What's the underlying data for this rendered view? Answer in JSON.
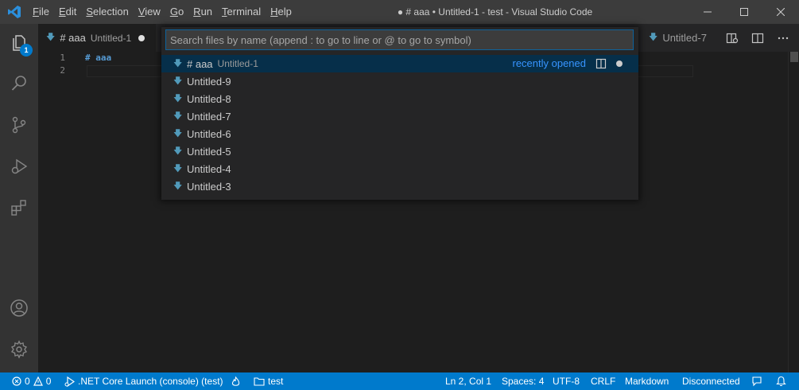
{
  "titlebar": {
    "menu": [
      "File",
      "Edit",
      "Selection",
      "View",
      "Go",
      "Run",
      "Terminal",
      "Help"
    ],
    "menu_mnemonics": [
      "F",
      "E",
      "S",
      "V",
      "G",
      "R",
      "T",
      "H"
    ],
    "title": "● # aaa • Untitled-1 - test - Visual Studio Code"
  },
  "activity": {
    "explorer_badge": "1"
  },
  "tabs": {
    "active": {
      "label": "# aaa",
      "description": "Untitled-1"
    },
    "other": {
      "label": "Untitled-7"
    }
  },
  "editor": {
    "lines": [
      {
        "number": "1",
        "text": "# aaa"
      },
      {
        "number": "2",
        "text": ""
      }
    ]
  },
  "quick_open": {
    "placeholder": "Search files by name (append : to go to line or @ to go to symbol)",
    "value": "",
    "items": [
      {
        "label": "# aaa",
        "description": "Untitled-1",
        "tag": "recently opened"
      },
      {
        "label": "Untitled-9"
      },
      {
        "label": "Untitled-8"
      },
      {
        "label": "Untitled-7"
      },
      {
        "label": "Untitled-6"
      },
      {
        "label": "Untitled-5"
      },
      {
        "label": "Untitled-4"
      },
      {
        "label": "Untitled-3"
      }
    ]
  },
  "statusbar": {
    "errors": "0",
    "warnings": "0",
    "launch": ".NET Core Launch (console) (test)",
    "folder": "test",
    "position": "Ln 2, Col 1",
    "spaces": "Spaces: 4",
    "encoding": "UTF-8",
    "eol": "CRLF",
    "language": "Markdown",
    "connection": "Disconnected"
  },
  "colors": {
    "accent": "#007acc",
    "titlebar": "#3c3c3c",
    "activitybar": "#333333",
    "editor": "#1e1e1e",
    "markdown_icon": "#519aba",
    "link": "#3794ff"
  }
}
